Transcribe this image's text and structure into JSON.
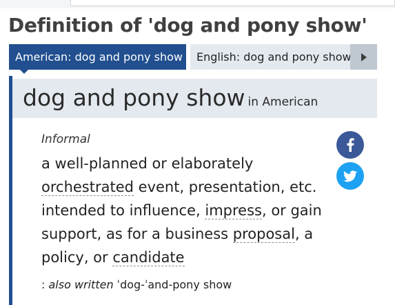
{
  "page_title": "Definition of 'dog and pony show'",
  "tabs": [
    {
      "label": "American: dog and pony show",
      "active": true
    },
    {
      "label": "English: dog and pony show",
      "active": false
    }
  ],
  "tab_next_icon": "caret-right-icon",
  "entry": {
    "headword": "dog and pony show",
    "language": "in American",
    "label": "Informal",
    "definition_parts": [
      "a well-planned or elaborately ",
      "orchestrated",
      " event, presentation, etc. intended to influence, ",
      "impress",
      ", or gain support, as for a business ",
      "proposal",
      ", a policy, or ",
      "candidate"
    ],
    "variant_prefix": ": ",
    "variant_label": "also written",
    "variant_form": " ˈdog-ˈand-pony show"
  },
  "share": {
    "facebook_icon": "facebook-icon",
    "twitter_icon": "twitter-icon"
  },
  "colors": {
    "accent": "#214f8f",
    "band": "#e4e9ef",
    "facebook": "#3b5998",
    "twitter": "#1da1f2"
  }
}
